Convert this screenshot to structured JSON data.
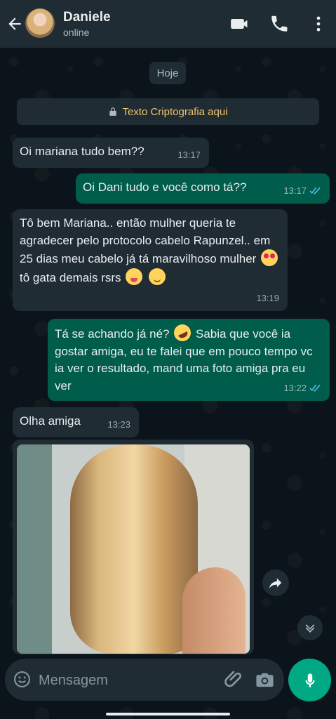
{
  "header": {
    "name": "Daniele",
    "status": "online",
    "icons": [
      "back-arrow-icon",
      "video-call-icon",
      "phone-icon",
      "more-vertical-icon"
    ]
  },
  "date_label": "Hoje",
  "encryption_notice": "Texto Criptografia aqui",
  "messages": [
    {
      "direction": "incoming",
      "text": "Oi mariana tudo bem??",
      "time": "13:17"
    },
    {
      "direction": "outgoing",
      "text": "Oi Dani tudo e você como tá??",
      "time": "13:17"
    },
    {
      "direction": "incoming",
      "text_before_emoji": "Tô bem Mariana.. então mulher queria te agradecer pelo protocolo cabelo Rapunzel.. em 25 dias meu cabelo já tá maravilhoso mulher",
      "text_after_emoji": " tô gata demais rsrs",
      "time": "13:19"
    },
    {
      "direction": "outgoing",
      "text_before_emoji": "Tá se achando já né?",
      "text_after_emoji": "Sabia que você ia gostar amiga, eu te falei que em pouco tempo vc ia ver o resultado, mand uma foto amiga pra eu ver",
      "time": "13:22"
    },
    {
      "direction": "incoming",
      "text": "Olha amiga",
      "time": "13:23"
    }
  ],
  "image_message": {
    "icon": "hair-photo-icon"
  },
  "composer": {
    "placeholder": "Mensagem"
  },
  "colors": {
    "header": "#1f2c34",
    "incoming": "#1f2c34",
    "outgoing": "#005c4b",
    "accent": "#00a884",
    "read_ticks": "#53bdeb"
  }
}
